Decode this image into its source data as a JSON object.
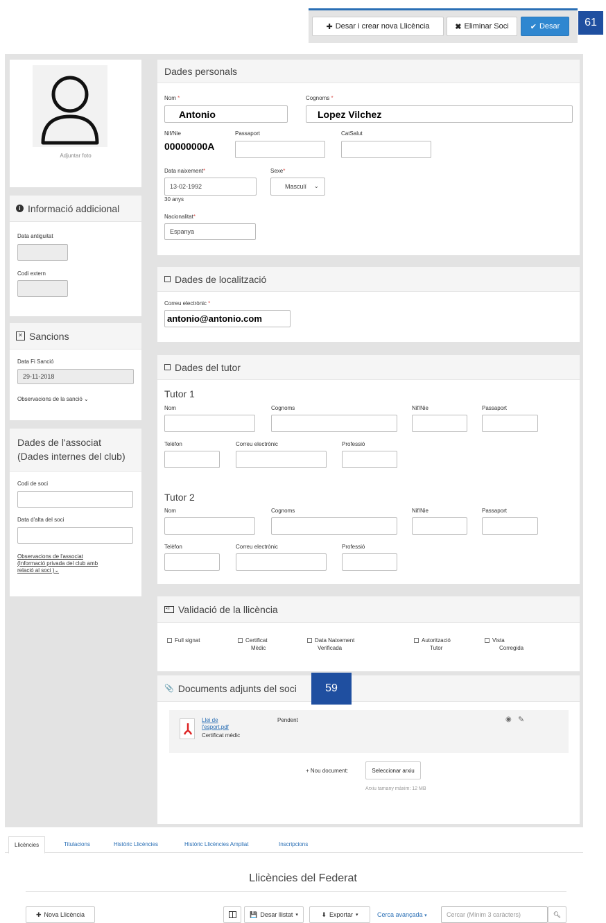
{
  "toolbar": {
    "save_new_license": "Desar i crear nova Llicència",
    "delete_member": "Eliminar Soci",
    "save": "Desar",
    "badge_top": "61"
  },
  "photo": {
    "attach_label": "Adjuntar foto"
  },
  "additional_info": {
    "title": "Informació addicional",
    "seniority_label": "Data antiguitat",
    "external_code_label": "Codi extern"
  },
  "sanctions": {
    "title": "Sancions",
    "end_date_label": "Data Fi Sanció",
    "end_date_value": "29-11-2018",
    "observations": "Observacions de la sanció ⌄"
  },
  "associate": {
    "title_line1": "Dades de l'associat",
    "title_line2": "(Dades internes del club)",
    "member_code_label": "Codi de soci",
    "signup_date_label": "Data d'alta del soci",
    "observations_l1": "Observacions de l'associat",
    "observations_l2": "(Informació privada del club amb",
    "observations_l3": "relació al soci )⌄"
  },
  "personal": {
    "title": "Dades personals",
    "name_label": "Nom",
    "name_value": "Antonio",
    "surname_label": "Cognoms",
    "surname_value": "Lopez Vilchez",
    "nif_label": "Nif/Nie",
    "nif_value": "00000000A",
    "passport_label": "Passaport",
    "catsalut_label": "CatSalut",
    "birth_label": "Data naixement",
    "birth_value": "13-02-1992",
    "age_text": "30 anys",
    "sex_label": "Sexe",
    "sex_value": "Masculí",
    "nationality_label": "Nacionalitat",
    "nationality_value": "Espanya",
    "required_mark": "*"
  },
  "location": {
    "title": "Dades de localització",
    "email_label": "Correu electrònic",
    "email_value": "antonio@antonio.com"
  },
  "tutor": {
    "title": "Dades del tutor",
    "tutor1": "Tutor 1",
    "tutor2": "Tutor 2",
    "nom": "Nom",
    "cognoms": "Cognoms",
    "nif": "Nif/Nie",
    "passport": "Passaport",
    "phone": "Telèfon",
    "email": "Correu electrònic",
    "profession": "Professió"
  },
  "validation": {
    "title": "Validació de la llicència",
    "full_signat": "Full signat",
    "cert_l1": "Certificat",
    "cert_l2": "Mèdic",
    "birth_l1": "Data Naixement",
    "birth_l2": "Verificada",
    "auth_l1": "Autorització",
    "auth_l2": "Tutor",
    "vista_l1": "Vista",
    "vista_l2": "Corregida"
  },
  "documents": {
    "title": "Documents adjunts del soci",
    "badge": "59",
    "file_l1": "Llei de",
    "file_l2": "l'esport.pdf",
    "file_type": "Certificat mèdic",
    "status": "Pendent",
    "new_doc": "+ Nou document:",
    "select_file": "Seleccionar arxiu",
    "max_size": "Arxiu tamany màxim: 12 MB"
  },
  "tabs": [
    "Llicències",
    "Titulacions",
    "Històric Llicències",
    "Històric Llicències Ampliat",
    "Inscripcions"
  ],
  "licenses": {
    "title": "Llicències del Federat",
    "new_license": "Nova Llicència",
    "save_list": "Desar llistat",
    "export": "Exportar",
    "advanced_search": "Cerca avançada",
    "search_placeholder": "Cercar (Mínim 3 caràcters)"
  }
}
